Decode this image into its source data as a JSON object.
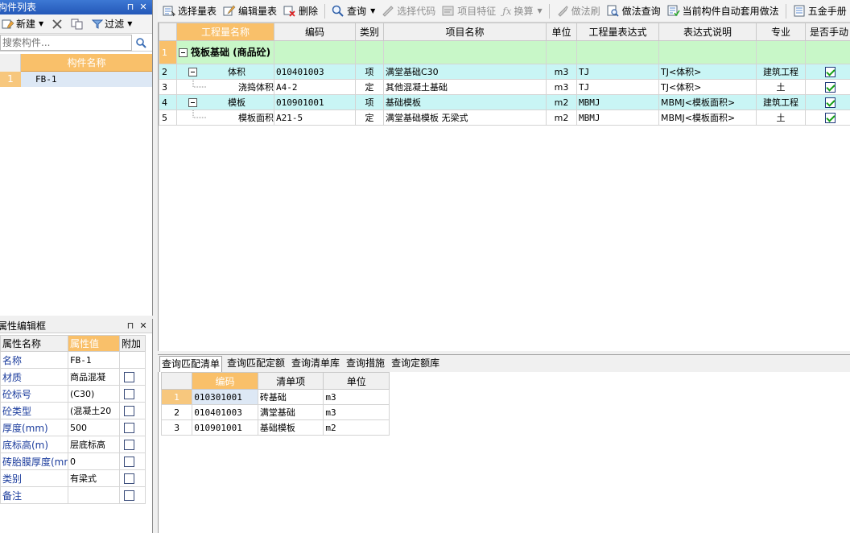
{
  "component_list": {
    "title": "构件列表",
    "new_label": "新建",
    "filter_label": "过滤",
    "search_placeholder": "搜索构件...",
    "column_header": "构件名称",
    "rows": [
      {
        "num": "1",
        "name": "FB-1"
      }
    ]
  },
  "property_editor": {
    "title": "属性编辑框",
    "headers": {
      "name": "属性名称",
      "value": "属性值",
      "extra": "附加"
    },
    "rows": [
      {
        "name": "名称",
        "value": "FB-1"
      },
      {
        "name": "材质",
        "value": "商品混凝"
      },
      {
        "name": "砼标号",
        "value": "(C30)"
      },
      {
        "name": "砼类型",
        "value": "(混凝土20"
      },
      {
        "name": "厚度(mm)",
        "value": "500"
      },
      {
        "name": "底标高(m)",
        "value": "层底标高"
      },
      {
        "name": "砖胎膜厚度(mm",
        "value": "0"
      },
      {
        "name": "类别",
        "value": "有梁式"
      },
      {
        "name": "备注",
        "value": ""
      }
    ]
  },
  "toolbar": {
    "select_table": "选择量表",
    "edit_table": "编辑量表",
    "delete": "删除",
    "query": "查询",
    "select_code": "选择代码",
    "item_feature": "项目特征",
    "convert": "换算",
    "method_brush": "做法刷",
    "method_query": "做法查询",
    "auto_apply": "当前构件自动套用做法",
    "hardware_manual": "五金手册"
  },
  "main_grid": {
    "headers": [
      "工程量名称",
      "编码",
      "类别",
      "项目名称",
      "单位",
      "工程量表达式",
      "表达式说明",
      "专业",
      "是否手动"
    ],
    "rows": [
      {
        "num": "1",
        "name": "筏板基础 (商品砼)",
        "code": "",
        "type": "",
        "item": "",
        "unit": "",
        "expr": "",
        "desc": "",
        "major": ""
      },
      {
        "num": "2",
        "name": "体积",
        "code": "010401003",
        "type": "项",
        "item": "满堂基础C30",
        "unit": "m3",
        "expr": "TJ",
        "desc": "TJ<体积>",
        "major": "建筑工程"
      },
      {
        "num": "3",
        "name": "浇捣体积",
        "code": "A4-2",
        "type": "定",
        "item": "其他混凝土基础",
        "unit": "m3",
        "expr": "TJ",
        "desc": "TJ<体积>",
        "major": "土"
      },
      {
        "num": "4",
        "name": "模板",
        "code": "010901001",
        "type": "项",
        "item": "基础模板",
        "unit": "m2",
        "expr": "MBMJ",
        "desc": "MBMJ<模板面积>",
        "major": "建筑工程"
      },
      {
        "num": "5",
        "name": "模板面积",
        "code": "A21-5",
        "type": "定",
        "item": "满堂基础模板 无梁式",
        "unit": "m2",
        "expr": "MBMJ",
        "desc": "MBMJ<模板面积>",
        "major": "土"
      }
    ]
  },
  "bottom_tabs": [
    "查询匹配清单",
    "查询匹配定额",
    "查询清单库",
    "查询措施",
    "查询定额库"
  ],
  "match_grid": {
    "headers": [
      "编码",
      "清单项",
      "单位"
    ],
    "rows": [
      {
        "num": "1",
        "code": "010301001",
        "item": "砖基础",
        "unit": "m3"
      },
      {
        "num": "2",
        "code": "010401003",
        "item": "满堂基础",
        "unit": "m3"
      },
      {
        "num": "3",
        "code": "010901001",
        "item": "基础模板",
        "unit": "m2"
      }
    ]
  }
}
